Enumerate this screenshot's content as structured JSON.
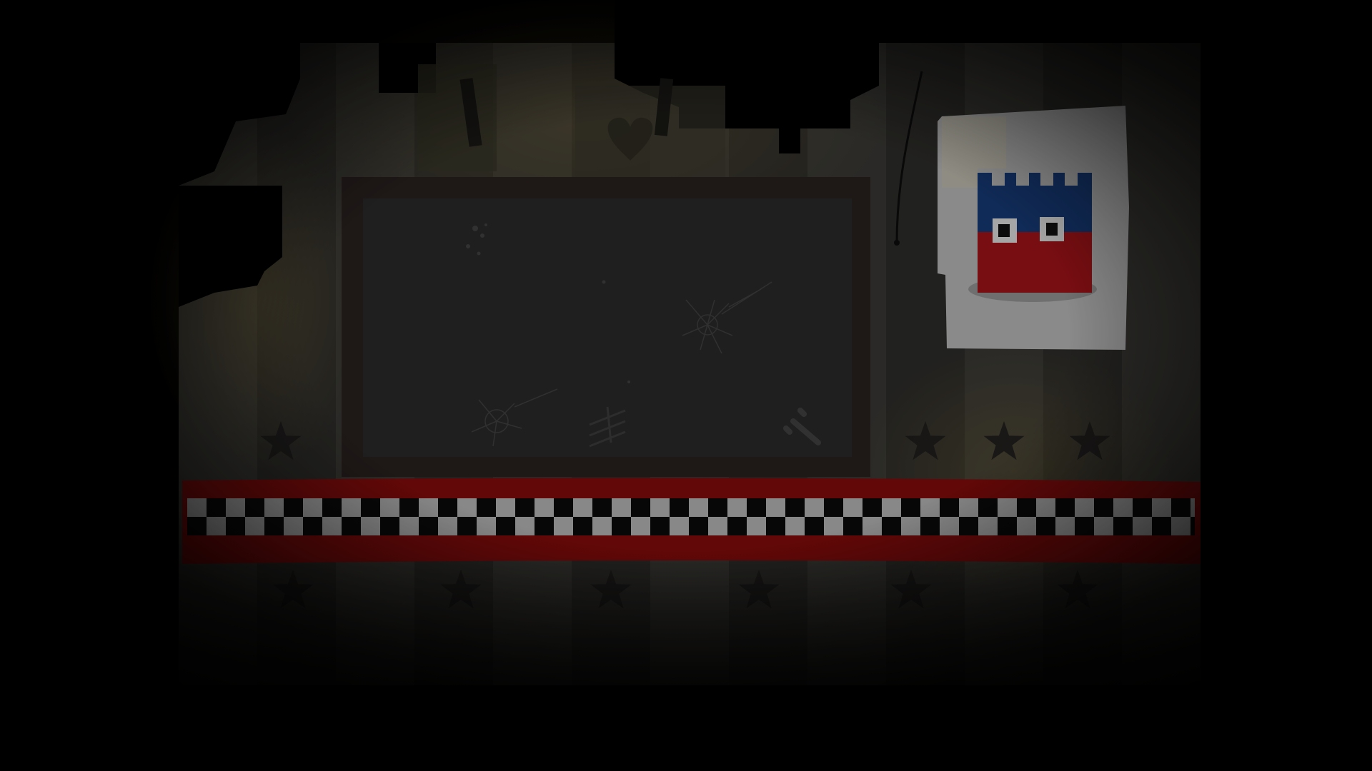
{
  "scene": {
    "setting": "dim office wall",
    "colors": {
      "background": "#000000",
      "wall_stripe_light": "#3b3a36",
      "wall_stripe_dark": "#2f2e2b",
      "monitor_frame": "#2a2220",
      "monitor_screen": "#2b2b2b",
      "red_band": "#8a0c0c",
      "checker_dark": "#0b0b0b",
      "checker_light": "#bdbdbd",
      "poster_paper": "#bfbfbf",
      "poster_blue": "#173c7a",
      "poster_red": "#a8141a",
      "star": "#1e1c1c",
      "warm_glow": "#7a6a3a"
    },
    "icons": [
      "heart-icon",
      "star-icon",
      "crack-icon",
      "scratch-icon",
      "castle-character-icon",
      "hanging-wire-icon"
    ]
  }
}
